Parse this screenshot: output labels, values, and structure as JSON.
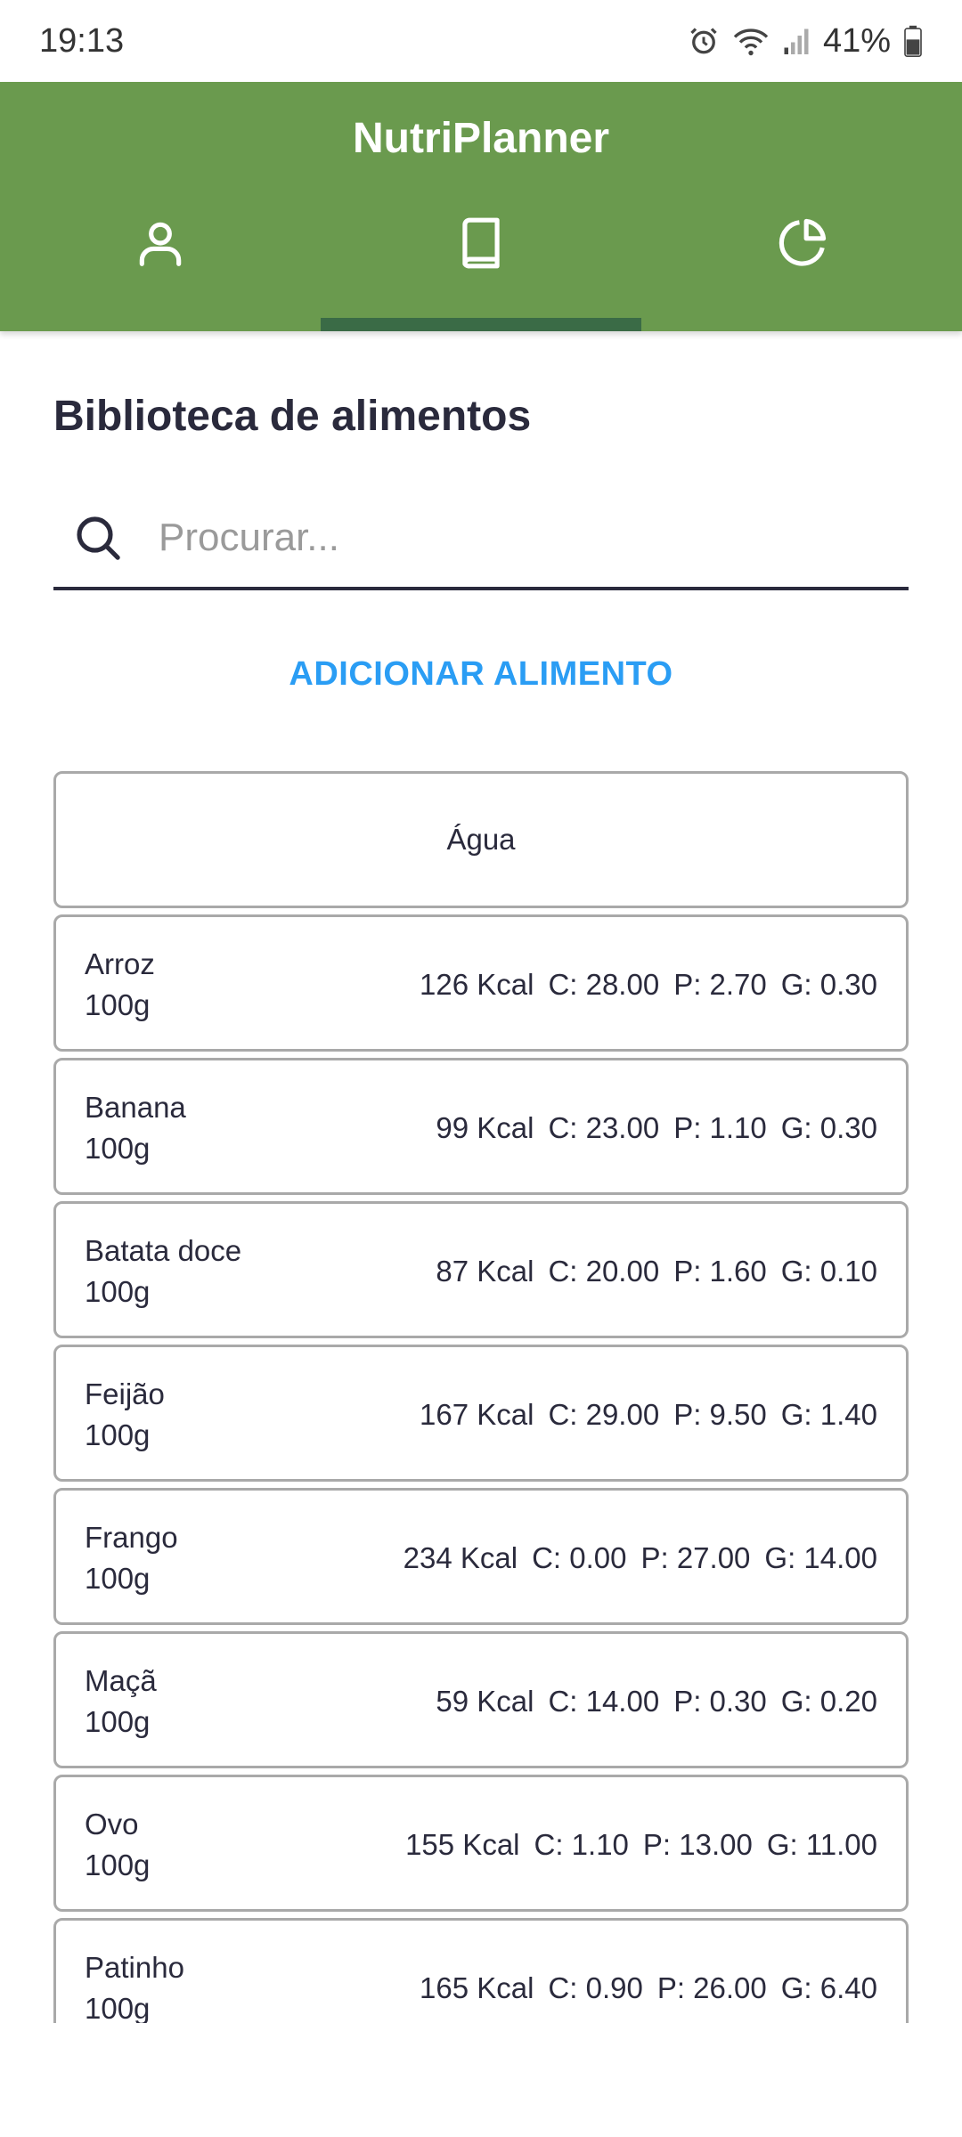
{
  "status_bar": {
    "time": "19:13",
    "battery": "41%"
  },
  "app": {
    "title": "NutriPlanner"
  },
  "tabs": [
    {
      "icon": "user-icon"
    },
    {
      "icon": "book-icon",
      "selected": true
    },
    {
      "icon": "pie-chart-icon"
    }
  ],
  "page": {
    "title": "Biblioteca de alimentos",
    "search_placeholder": "Procurar...",
    "search_value": "",
    "add_button": "ADICIONAR ALIMENTO"
  },
  "list_header": "Água",
  "foods": [
    {
      "name": "Arroz",
      "qty": "100g",
      "kcal": "126 Kcal",
      "c": "C: 28.00",
      "p": "P: 2.70",
      "g": "G: 0.30"
    },
    {
      "name": "Banana",
      "qty": "100g",
      "kcal": "99 Kcal",
      "c": "C: 23.00",
      "p": "P: 1.10",
      "g": "G: 0.30"
    },
    {
      "name": "Batata doce",
      "qty": "100g",
      "kcal": "87 Kcal",
      "c": "C: 20.00",
      "p": "P: 1.60",
      "g": "G: 0.10"
    },
    {
      "name": "Feijão",
      "qty": "100g",
      "kcal": "167 Kcal",
      "c": "C: 29.00",
      "p": "P: 9.50",
      "g": "G: 1.40"
    },
    {
      "name": "Frango",
      "qty": "100g",
      "kcal": "234 Kcal",
      "c": "C: 0.00",
      "p": "P: 27.00",
      "g": "G: 14.00"
    },
    {
      "name": "Maçã",
      "qty": "100g",
      "kcal": "59 Kcal",
      "c": "C: 14.00",
      "p": "P: 0.30",
      "g": "G: 0.20"
    },
    {
      "name": "Ovo",
      "qty": "100g",
      "kcal": "155 Kcal",
      "c": "C: 1.10",
      "p": "P: 13.00",
      "g": "G: 11.00"
    },
    {
      "name": "Patinho",
      "qty": "100g",
      "kcal": "165 Kcal",
      "c": "C: 0.90",
      "p": "P: 26.00",
      "g": "G: 6.40"
    }
  ],
  "colors": {
    "primary": "#6a9a4e",
    "indicator": "#3a6b46",
    "accent": "#2a9df4",
    "text": "#2a2a3c"
  }
}
